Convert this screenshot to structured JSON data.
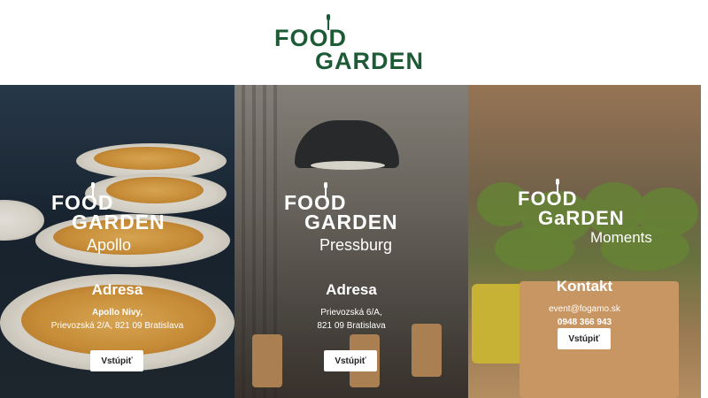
{
  "header": {
    "logo_line1": "FOOD",
    "logo_line2": "GARDEN"
  },
  "colors": {
    "brand_green": "#1d5a36",
    "button_bg": "#ffffff"
  },
  "panels": [
    {
      "logo_line1": "FOOD",
      "logo_line2": "GARDEN",
      "logo_sub": "Apollo",
      "heading": "Adresa",
      "line1": "Apollo Nivy,",
      "line2": "Prievozská 2/A, 821 09 Bratislava",
      "button": "Vstúpiť"
    },
    {
      "logo_line1": "FOOD",
      "logo_line2": "GARDEN",
      "logo_sub": "Pressburg",
      "heading": "Adresa",
      "line1": "Prievozská 6/A,",
      "line2": "821 09 Bratislava",
      "button": "Vstúpiť"
    },
    {
      "logo_line1": "FOOD",
      "logo_line2": "GaRDEN",
      "logo_sub": "Moments",
      "heading": "Kontakt",
      "line1": "event@fogamo.sk",
      "line2": "0948 366 943",
      "button": "Vstúpiť"
    }
  ],
  "icons": [
    "fork-icon"
  ]
}
